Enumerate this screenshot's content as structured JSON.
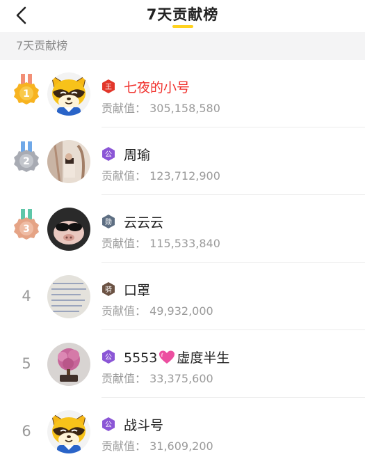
{
  "header": {
    "title": "7天贡献榜",
    "back_icon": "back-chevron-icon"
  },
  "section": {
    "label": "7天贡献榜"
  },
  "colors": {
    "accent": "#ffd21f",
    "top_name": "#f0302c",
    "gold": "#f7b320",
    "silver": "#a8abb3",
    "bronze": "#e5a385"
  },
  "list": [
    {
      "rank": "1",
      "medal": "gold-medal-icon",
      "badge": "王",
      "badge_type": "king",
      "name": "七夜的小号",
      "value_label": "贡献值：",
      "value": "305,158,580"
    },
    {
      "rank": "2",
      "medal": "silver-medal-icon",
      "badge": "公",
      "badge_type": "duke",
      "name": "周瑜",
      "value_label": "贡献值：",
      "value": "123,712,900"
    },
    {
      "rank": "3",
      "medal": "bronze-medal-icon",
      "badge": "勋",
      "badge_type": "count",
      "name": "云云云",
      "value_label": "贡献值：",
      "value": "115,533,840"
    },
    {
      "rank": "4",
      "badge": "骑",
      "badge_type": "knight",
      "name": "口罩",
      "value_label": "贡献值：",
      "value": "49,932,000"
    },
    {
      "rank": "5",
      "badge": "公",
      "badge_type": "duke",
      "name_pre": "5553",
      "name_post": "虚度半生",
      "value_label": "贡献值：",
      "value": "33,375,600"
    },
    {
      "rank": "6",
      "badge": "公",
      "badge_type": "duke",
      "name": "战斗号",
      "value_label": "贡献值：",
      "value": "31,609,200"
    }
  ]
}
